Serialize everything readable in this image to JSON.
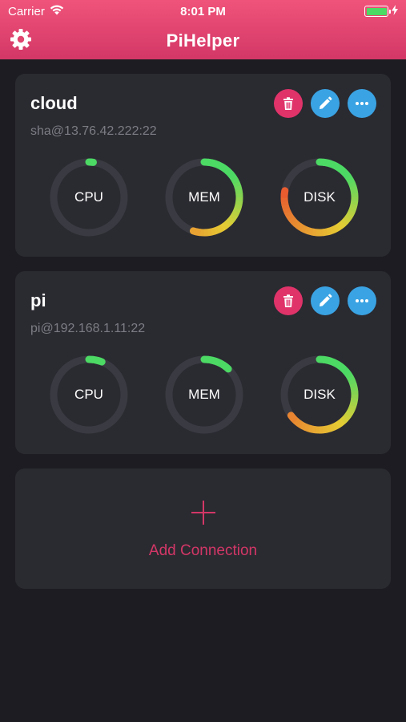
{
  "status_bar": {
    "carrier": "Carrier",
    "time": "8:01 PM",
    "battery_level": 1.0
  },
  "nav": {
    "title": "PiHelper",
    "settings_icon": "gear-icon"
  },
  "gauge_colors": {
    "track": "#3a3a42",
    "low": "#4cd964",
    "mid": "#e6cc33",
    "high": "#e8452f"
  },
  "connections": [
    {
      "name": "cloud",
      "host": "sha@13.76.42.222:22",
      "actions": {
        "delete_icon": "trash-icon",
        "edit_icon": "pencil-icon",
        "more_icon": "ellipsis-icon"
      },
      "gauges": [
        {
          "label": "CPU",
          "value": 0.02
        },
        {
          "label": "MEM",
          "value": 0.55
        },
        {
          "label": "DISK",
          "value": 0.78
        }
      ]
    },
    {
      "name": "pi",
      "host": "pi@192.168.1.11:22",
      "actions": {
        "delete_icon": "trash-icon",
        "edit_icon": "pencil-icon",
        "more_icon": "ellipsis-icon"
      },
      "gauges": [
        {
          "label": "CPU",
          "value": 0.06
        },
        {
          "label": "MEM",
          "value": 0.12
        },
        {
          "label": "DISK",
          "value": 0.65
        }
      ]
    }
  ],
  "add_connection": {
    "label": "Add Connection",
    "icon": "plus-icon"
  }
}
